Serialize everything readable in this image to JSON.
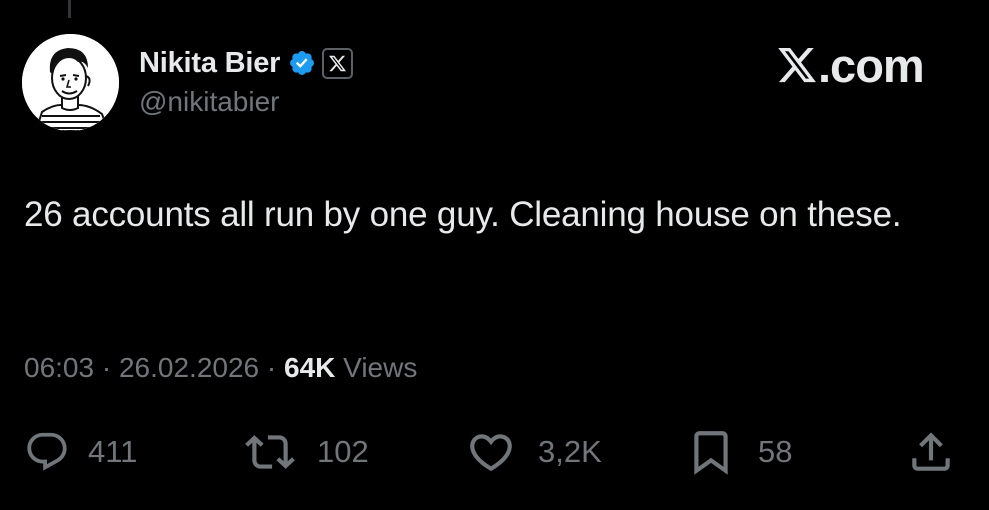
{
  "author": {
    "display_name": "Nikita Bier",
    "handle": "@nikitabier",
    "verified": true,
    "affiliation_icon": "x-logo-icon"
  },
  "brand": {
    "label": ".com",
    "logo_icon": "x-logo-icon"
  },
  "tweet": {
    "text": "26 accounts all run by one guy. Cleaning house on these.",
    "time": "06:03",
    "date": "26.02.2026",
    "views_count": "64K",
    "views_label": "Views",
    "separator": "·"
  },
  "actions": {
    "replies": "411",
    "reposts": "102",
    "likes": "3,2K",
    "bookmarks": "58"
  },
  "colors": {
    "background": "#000000",
    "text": "#e7e9ea",
    "secondary": "#71767b",
    "verified_blue": "#1d9bf0"
  }
}
